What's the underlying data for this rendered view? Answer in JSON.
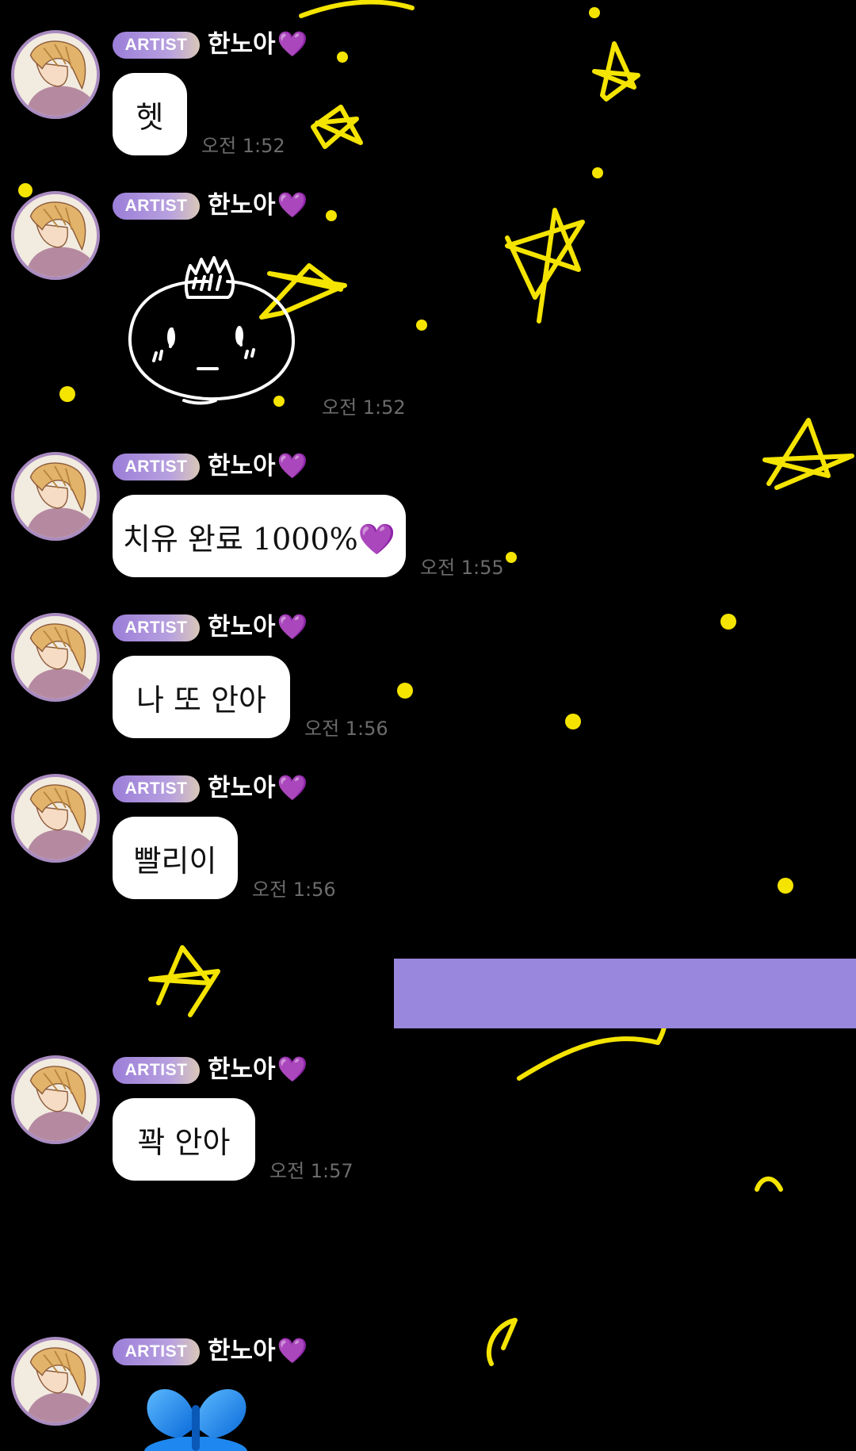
{
  "sender": {
    "badge": "ARTIST",
    "name": "한노아",
    "heart_icon": "purple-heart-icon",
    "accent_color": "#9b7ed8"
  },
  "messages": [
    {
      "text": "헷",
      "time": "오전 1:52"
    },
    {
      "sticker": "white-dumpling-crown-sticker",
      "time": "오전 1:52"
    },
    {
      "text": "치유 완료 1000%💜",
      "time": "오전 1:55"
    },
    {
      "text": "나 또 안아",
      "time": "오전 1:56"
    },
    {
      "text": "빨리이",
      "time": "오전 1:56"
    },
    {
      "text": "꽉 안아",
      "time": "오전 1:57"
    },
    {
      "sticker": "blue-butterfly-sticker"
    }
  ],
  "colors": {
    "background": "#000000",
    "doodle": "#ffeb00",
    "overlay_bar": "#9986dd",
    "timestamp": "#6b6b6b"
  }
}
